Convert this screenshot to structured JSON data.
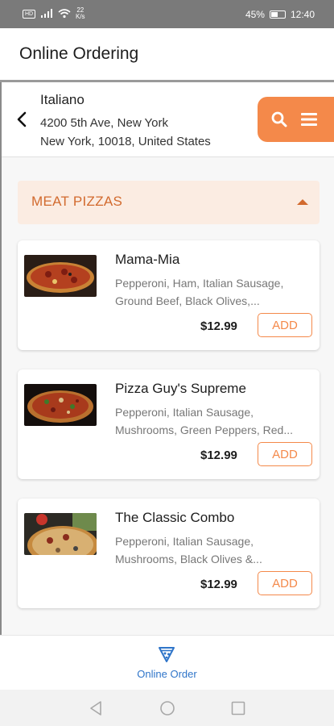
{
  "status_bar": {
    "sim": "HD",
    "net_speed_value": "22",
    "net_speed_unit": "K/s",
    "battery": "45%",
    "time": "12:40"
  },
  "header": {
    "title": "Online Ordering"
  },
  "store": {
    "name": "Italiano",
    "address_line1": "4200 5th Ave, New York",
    "address_line2": "New York, 10018, United States"
  },
  "category": {
    "title": "MEAT PIZZAS"
  },
  "items": [
    {
      "name": "Mama-Mia",
      "desc_line1": "Pepperoni, Ham, Italian Sausage,",
      "desc_line2": "Ground Beef, Black Olives,...",
      "price": "$12.99",
      "add_label": "ADD"
    },
    {
      "name": "Pizza Guy's Supreme",
      "desc_line1": "Pepperoni, Italian Sausage,",
      "desc_line2": "Mushrooms, Green Peppers, Red...",
      "price": "$12.99",
      "add_label": "ADD"
    },
    {
      "name": "The Classic Combo",
      "desc_line1": "Pepperoni, Italian Sausage,",
      "desc_line2": "Mushrooms, Black Olives &...",
      "price": "$12.99",
      "add_label": "ADD"
    }
  ],
  "bottom_nav": {
    "label": "Online Order"
  },
  "colors": {
    "accent": "#f4894a",
    "category_bg": "#fbece2",
    "category_text": "#d26a2e",
    "nav_active": "#2f75c9"
  }
}
